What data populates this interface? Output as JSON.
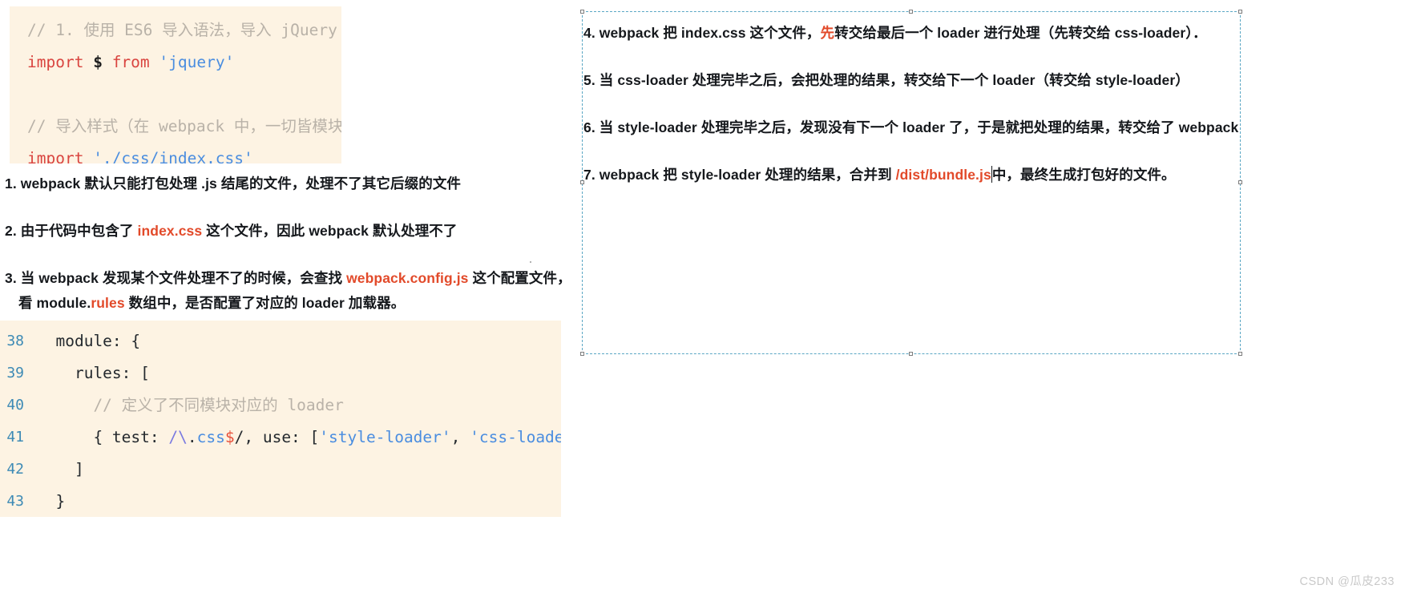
{
  "top_code": {
    "lines": [
      [
        {
          "t": "// 1. 使用 ES6 导入语法，导入 jQuery",
          "c": "tok-comment"
        }
      ],
      [
        {
          "t": "import ",
          "c": "tok-keyword"
        },
        {
          "t": "$",
          "c": "tok-var"
        },
        {
          "t": " ",
          "c": "tok-plain"
        },
        {
          "t": "from ",
          "c": "tok-keyword"
        },
        {
          "t": "'jquery'",
          "c": "tok-string"
        }
      ],
      [
        {
          "t": " ",
          "c": "tok-plain"
        }
      ],
      [
        {
          "t": "// 导入样式（在 webpack 中，一切皆模块，",
          "c": "tok-comment"
        }
      ],
      [
        {
          "t": "import ",
          "c": "tok-keyword"
        },
        {
          "t": "'./css/index.css'",
          "c": "tok-string"
        }
      ]
    ]
  },
  "notes": [
    {
      "lines": [
        [
          {
            "t": "1. webpack 默认只能打包处理 .js 结尾的文件，处理不了其它后缀的文件",
            "c": ""
          }
        ]
      ]
    },
    {
      "lines": [
        [
          {
            "t": "2. 由于代码中包含了 ",
            "c": ""
          },
          {
            "t": "index.css",
            "c": "hl-red"
          },
          {
            "t": " 这个文件，因此 webpack 默认处理不了",
            "c": ""
          }
        ]
      ]
    },
    {
      "lines": [
        [
          {
            "t": "3. 当 webpack 发现某个文件处理不了的时候，会查找 ",
            "c": ""
          },
          {
            "t": "webpack.config.js",
            "c": "hl-red"
          },
          {
            "t": " 这个配置文件，",
            "c": ""
          }
        ],
        [
          {
            "t": "看 module.",
            "c": ""
          },
          {
            "t": "rules",
            "c": "hl-red"
          },
          {
            "t": " 数组中，是否配置了对应的 loader 加载器。",
            "c": ""
          }
        ]
      ]
    }
  ],
  "bottom_code": {
    "lines": [
      {
        "no": "38",
        "parts": [
          {
            "t": "  module: {",
            "c": "tok-plain"
          }
        ]
      },
      {
        "no": "39",
        "parts": [
          {
            "t": "    rules: [",
            "c": "tok-plain"
          }
        ]
      },
      {
        "no": "40",
        "parts": [
          {
            "t": "      // 定义了不同模块对应的 loader",
            "c": "tok-comment"
          }
        ]
      },
      {
        "no": "41",
        "parts": [
          {
            "t": "      { test: ",
            "c": "tok-plain"
          },
          {
            "t": "/",
            "c": "tok-regex"
          },
          {
            "t": "\\",
            "c": "tok-regex"
          },
          {
            "t": ".",
            "c": "tok-plain"
          },
          {
            "t": "css",
            "c": "tok-regex-b"
          },
          {
            "t": "$",
            "c": "tok-dollar"
          },
          {
            "t": "/",
            "c": "tok-plain"
          },
          {
            "t": ", use: [",
            "c": "tok-plain"
          },
          {
            "t": "'style-loader'",
            "c": "tok-string"
          },
          {
            "t": ", ",
            "c": "tok-plain"
          },
          {
            "t": "'css-loader'",
            "c": "tok-string"
          },
          {
            "t": "] }",
            "c": "tok-plain"
          }
        ]
      },
      {
        "no": "42",
        "parts": [
          {
            "t": "    ]",
            "c": "tok-plain"
          }
        ]
      },
      {
        "no": "43",
        "parts": [
          {
            "t": "  }",
            "c": "tok-plain"
          }
        ]
      }
    ]
  },
  "steps": [
    {
      "parts": [
        {
          "t": "4. webpack 把 index.css 这个文件，",
          "c": ""
        },
        {
          "t": "先",
          "c": "hl-red"
        },
        {
          "t": "转交给最后一个 loader 进行处理（先转交给 css-loader）．",
          "c": ""
        }
      ]
    },
    {
      "parts": [
        {
          "t": "5. 当 css-loader 处理完毕之后，会把处理的结果，转交给下一个 loader（转交给 style-loader）",
          "c": ""
        }
      ]
    },
    {
      "parts": [
        {
          "t": "6. 当 style-loader 处理完毕之后，发现没有下一个 loader 了，于是就把处理的结果，转交给了 webpack",
          "c": ""
        }
      ]
    },
    {
      "parts": [
        {
          "t": "7. webpack 把 style-loader 处理的结果，合并到 ",
          "c": ""
        },
        {
          "t": "/dist/bundle.js",
          "c": "hl-red"
        },
        {
          "t": "",
          "c": "caret"
        },
        {
          "t": "中，最终生成打包好的文件。",
          "c": ""
        }
      ]
    }
  ],
  "watermark": "CSDN @瓜皮233",
  "colors": {
    "code_background": "#fdf3e3",
    "accent_red": "#e24a2a",
    "keyword_red": "#d9443f",
    "string_blue": "#4a8de0",
    "line_number_blue": "#3d8ab5",
    "selection_border": "#5aa7c4"
  }
}
